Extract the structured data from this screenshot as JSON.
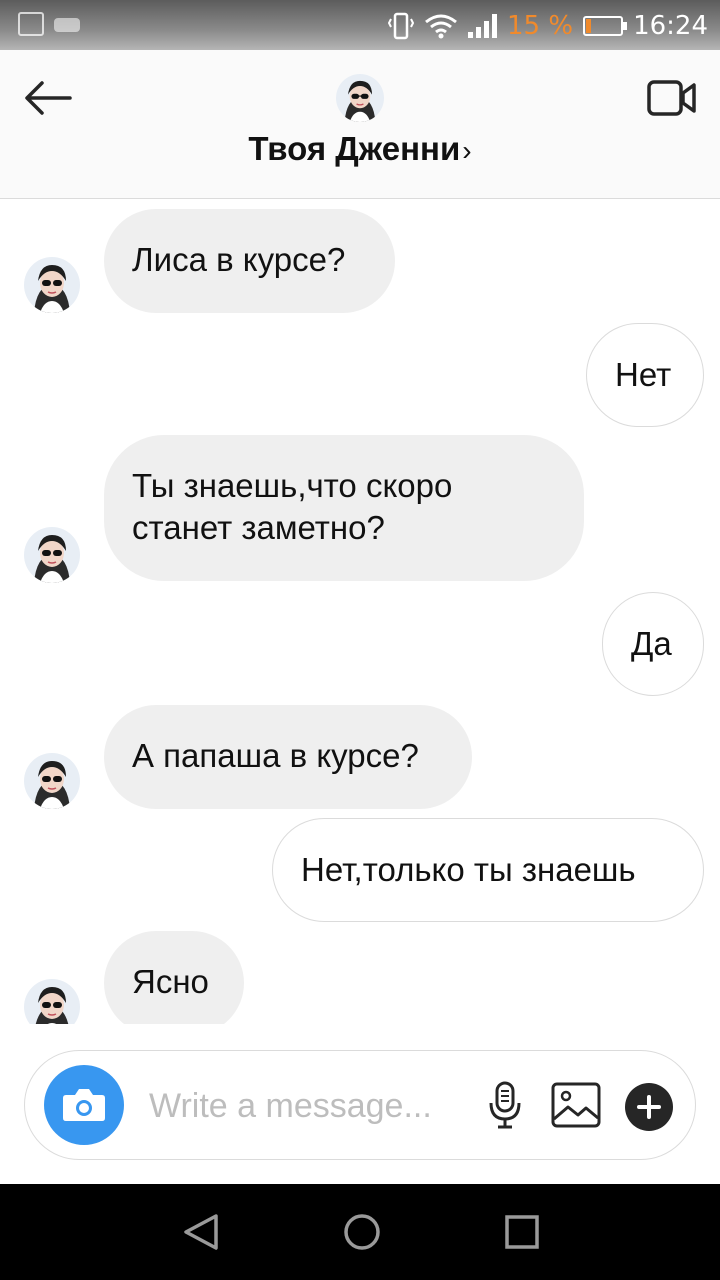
{
  "status_bar": {
    "battery_percent": "15 %",
    "battery_level": 0.15,
    "time": "16:24",
    "icons": [
      "image-notification-icon",
      "voicemail-icon",
      "vibrate-icon",
      "wifi-icon",
      "signal-icon",
      "battery-icon"
    ]
  },
  "header": {
    "title": "Твоя Дженни",
    "chevron": "›",
    "icons": [
      "back-arrow-icon",
      "video-call-icon",
      "chevron-right-icon"
    ]
  },
  "messages": [
    {
      "side": "in",
      "text": "Лиса в курсе?"
    },
    {
      "side": "out",
      "text": "Нет"
    },
    {
      "side": "in",
      "text": "Ты знаешь,что скоро станет заметно?"
    },
    {
      "side": "out",
      "text": "Да"
    },
    {
      "side": "in",
      "text": "А папаша в курсе?"
    },
    {
      "side": "out",
      "text": "Нет,только ты знаешь"
    },
    {
      "side": "in",
      "text": "Ясно"
    }
  ],
  "composer": {
    "placeholder": "Write a message...",
    "icons": [
      "camera-icon",
      "microphone-icon",
      "gallery-icon",
      "plus-icon"
    ]
  },
  "colors": {
    "accent": "#3897f0",
    "incoming_bubble": "#efefef",
    "battery_low": "#f08a2c"
  },
  "nav": {
    "icons": [
      "back-triangle-icon",
      "home-circle-icon",
      "recents-square-icon"
    ]
  }
}
